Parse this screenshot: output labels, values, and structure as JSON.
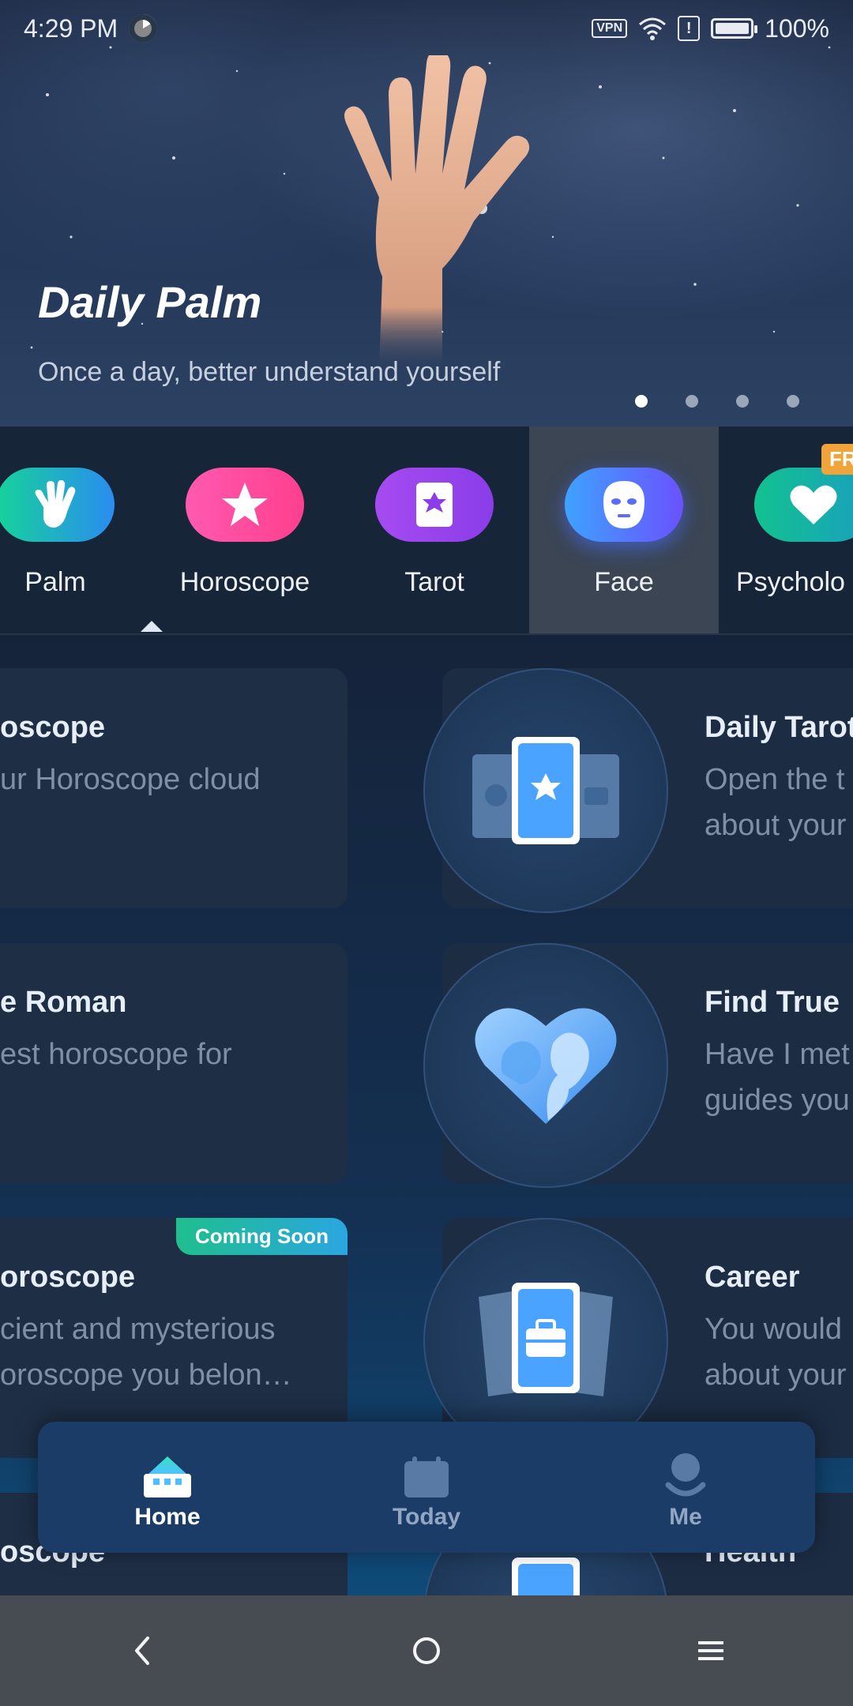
{
  "status_bar": {
    "time": "4:29 PM",
    "vpn": "VPN",
    "alert": "!",
    "battery_text": "100%",
    "battery_level": 1.0
  },
  "banner": {
    "title": "Daily Palm",
    "subtitle": "Once a day, better understand yourself",
    "page_count": 4,
    "active_page": 1
  },
  "categories": [
    {
      "label": "Palm",
      "icon": "palm-icon",
      "color": "#19c79a"
    },
    {
      "label": "Horoscope",
      "icon": "star-icon",
      "color": "#ff4fa6"
    },
    {
      "label": "Tarot",
      "icon": "tarot-card-icon",
      "color": "#9b47f0"
    },
    {
      "label": "Face",
      "icon": "face-mask-icon",
      "color": "#4a6bff"
    },
    {
      "label": "Psycholo",
      "icon": "heart-icon",
      "color": "#18b6a0",
      "badge": "FR"
    }
  ],
  "cards_left": [
    {
      "title": "oscope",
      "desc": [
        "ur Horoscope cloud"
      ]
    },
    {
      "title": "e Roman",
      "desc": [
        "est horoscope for"
      ]
    },
    {
      "title": "oroscope",
      "desc": [
        "cient and mysterious",
        "oroscope you belon…"
      ],
      "badge": "Coming Soon"
    },
    {
      "title": "oscope",
      "desc": []
    }
  ],
  "cards_right": [
    {
      "title": "Daily Tarot",
      "desc": [
        "Open the t",
        "about your"
      ],
      "icon": "tarot-cards-icon"
    },
    {
      "title": "Find True ",
      "desc": [
        "Have I met",
        "guides you"
      ],
      "icon": "heart-couple-icon"
    },
    {
      "title": "Career",
      "desc": [
        "You would",
        "about your"
      ],
      "icon": "briefcase-card-icon"
    },
    {
      "title": "Health",
      "desc": [],
      "icon": "card-icon"
    }
  ],
  "bottom_nav": [
    {
      "label": "Home",
      "icon": "home-icon",
      "active": true
    },
    {
      "label": "Today",
      "icon": "calendar-icon",
      "active": false
    },
    {
      "label": "Me",
      "icon": "person-icon",
      "active": false
    }
  ],
  "system_nav": {
    "back": "back-icon",
    "home": "home-circle-icon",
    "menu": "menu-icon"
  }
}
